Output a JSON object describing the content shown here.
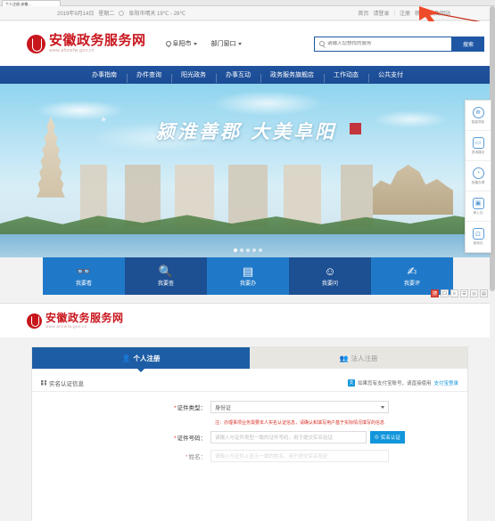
{
  "browser": {
    "tab_title": "个人注册-安徽…"
  },
  "topbar": {
    "date": "2019年9月14日",
    "weekday": "星期二",
    "weather_icon": "cloud-icon",
    "weather": "阜阳市晴天 19℃ - 28℃",
    "links": [
      "首页",
      "请登录",
      "注册",
      "移动A认及网站"
    ],
    "separator": "|"
  },
  "header": {
    "logo_title": "安徽政务服务网",
    "logo_sub": "www.ahzwfw.gov.cn",
    "city": "阜阳市",
    "department": "部门窗口",
    "search": {
      "placeholder": "请输入您想找的服务",
      "button": "搜索",
      "icon": "search-icon"
    }
  },
  "nav": {
    "items": [
      "办事指南",
      "办件查询",
      "阳光政务",
      "办事互动",
      "政务服务旗舰店",
      "工作动态",
      "公共支付"
    ]
  },
  "hero": {
    "calligraphy": "颍淮善郡  大美阜阳",
    "dots": 5,
    "active_dot": 1
  },
  "float_bar": {
    "items": [
      {
        "icon": "compass-icon",
        "label": "智能导航"
      },
      {
        "icon": "message-icon",
        "label": "咨询建议"
      },
      {
        "icon": "clock-icon",
        "label": "快捷办理"
      },
      {
        "icon": "monitor-icon",
        "label": "掌上办"
      },
      {
        "icon": "search-doc-icon",
        "label": "查询办"
      }
    ]
  },
  "quick_actions": {
    "items": [
      {
        "icon": "glasses-icon",
        "label": "我要看"
      },
      {
        "icon": "search-box-icon",
        "label": "我要查"
      },
      {
        "icon": "certificate-icon",
        "label": "我要办"
      },
      {
        "icon": "smiley-icon",
        "label": "我要问"
      },
      {
        "icon": "pencil-person-icon",
        "label": "我要评"
      }
    ]
  },
  "mini_tools": {
    "items": [
      "搜",
      "口",
      "≡",
      "☰",
      "◎",
      "▤"
    ]
  },
  "registration": {
    "logo_title": "安徽政务服务网",
    "logo_sub": "www.ahzwfw.gov.cn",
    "tabs": [
      {
        "label": "个人注册",
        "icon": "person-icon",
        "active": true
      },
      {
        "label": "法人注册",
        "icon": "org-icon",
        "active": false
      }
    ],
    "section_title": "实名认证信息",
    "section_icon": "grid-icon",
    "alipay_notice_prefix": "如果您有支付宝账号，请直接使用",
    "alipay_notice_link": "支付宝登录",
    "alipay_icon": "alipay-icon",
    "fields": [
      {
        "label": "证件类型：",
        "required": true,
        "type": "select",
        "value": "身份证",
        "caret_icon": "chevron-down-icon"
      },
      {
        "label": "证件号码：",
        "required": true,
        "type": "input",
        "placeholder": "请输入与证件类型一致的证件号码，用于提交实名验证",
        "button": {
          "label": "实名认证",
          "icon": "shield-icon"
        }
      },
      {
        "label": "姓名：",
        "required": true,
        "type": "input",
        "placeholder": "请输入与证件上显示一致的姓名，用于提交实名验证"
      }
    ],
    "notice": "注：办理事项业务需要本人实名认证信息，请确认和填写用户基于实际情况填写的信息"
  }
}
